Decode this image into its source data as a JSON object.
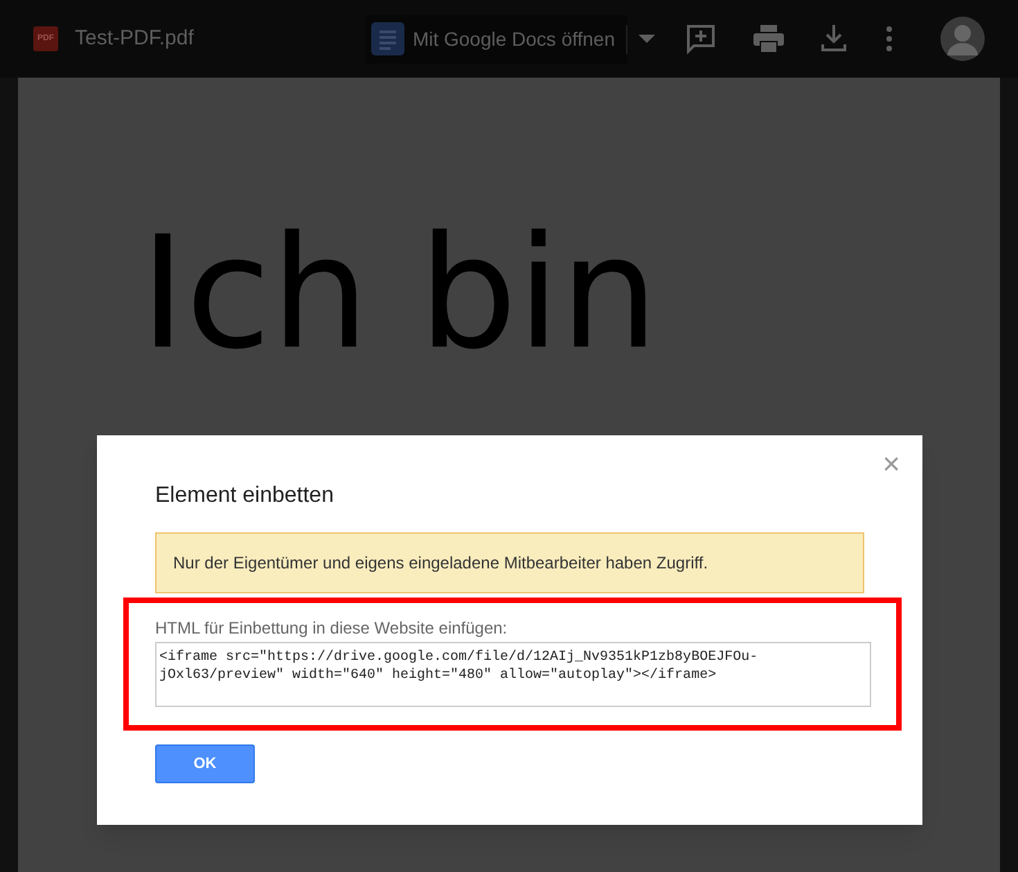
{
  "toolbar": {
    "file_badge": "PDF",
    "file_name": "Test-PDF.pdf",
    "open_with": "Mit Google Docs öffnen"
  },
  "document": {
    "text": "Ich bin"
  },
  "dialog": {
    "title": "Element einbetten",
    "close": "×",
    "notice": "Nur der Eigentümer und eigens eingeladene Mitbearbeiter haben Zugriff.",
    "embed_label": "HTML für Einbettung in diese Website einfügen:",
    "embed_code": "<iframe src=\"https://drive.google.com/file/d/12AIj_Nv9351kP1zb8yBOEJFOu-jOxl63/preview\" width=\"640\" height=\"480\" allow=\"autoplay\"></iframe>",
    "ok_button": "OK"
  }
}
